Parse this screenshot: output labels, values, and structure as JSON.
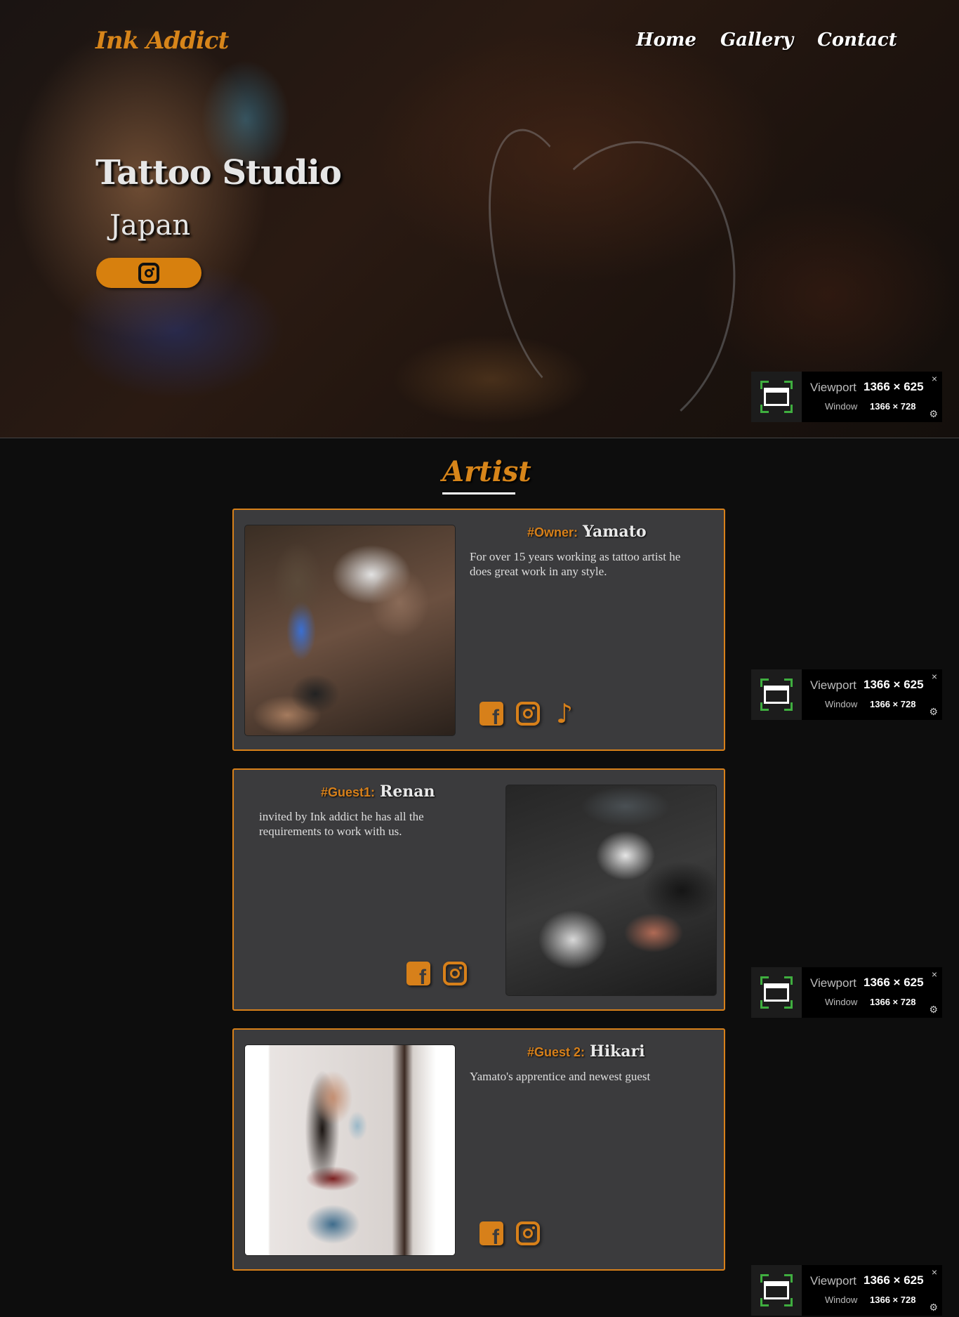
{
  "brand": {
    "logo": "Ink Addict"
  },
  "nav": {
    "items": [
      "Home",
      "Gallery",
      "Contact"
    ]
  },
  "hero": {
    "title": "Tattoo Studio",
    "subtitle": "Japan"
  },
  "artists_section": {
    "title": "Artist"
  },
  "artists": [
    {
      "tag": "#Owner:",
      "name": "Yamato",
      "description": "For over 15 years working as tattoo artist he does great work in any style.",
      "socials": [
        "facebook-icon",
        "instagram-icon",
        "tiktok-icon"
      ]
    },
    {
      "tag": "#Guest1:",
      "name": "Renan",
      "description": "invited by Ink addict he has all the requirements to work with us.",
      "socials": [
        "facebook-icon",
        "instagram-icon"
      ]
    },
    {
      "tag": "#Guest 2:",
      "name": "Hikari",
      "description": "Yamato's apprentice and newest guest",
      "socials": [
        "facebook-icon",
        "instagram-icon"
      ]
    }
  ],
  "viewport_widget": {
    "viewport_label": "Viewport",
    "viewport_value": "1366 × 625",
    "window_label": "Window",
    "window_value": "1366 × 728",
    "close": "×",
    "settings": "⚙"
  },
  "colors": {
    "accent": "#d7801a",
    "card_bg": "#3b3b3d",
    "page_bg": "#0d0d0d"
  }
}
